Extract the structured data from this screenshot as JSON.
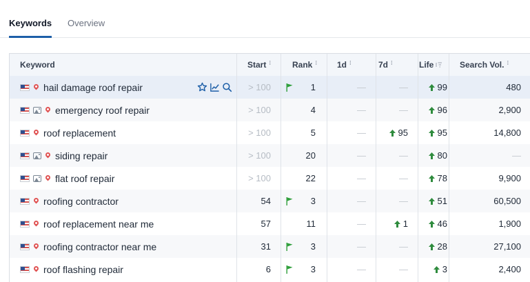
{
  "tabs": [
    {
      "label": "Keywords",
      "active": true
    },
    {
      "label": "Overview",
      "active": false
    }
  ],
  "columns": {
    "keyword": "Keyword",
    "start": "Start",
    "rank": "Rank",
    "d1": "1d",
    "d7": "7d",
    "life": "Life",
    "search_vol": "Search Vol."
  },
  "colors": {
    "accent": "#1d5fa8",
    "up_arrow": "#2e8b3d",
    "flag": "#2e9e3a"
  },
  "rows": [
    {
      "keyword": "hail damage roof repair",
      "image_icon": false,
      "start": "> 100",
      "start_muted": true,
      "rank_flag": true,
      "rank": "1",
      "d1": "—",
      "d1_up": false,
      "d7": "—",
      "d7_up": false,
      "life": "99",
      "life_up": true,
      "volume": "480",
      "volume_muted": false,
      "highlighted": true
    },
    {
      "keyword": "emergency roof repair",
      "image_icon": true,
      "start": "> 100",
      "start_muted": true,
      "rank_flag": false,
      "rank": "4",
      "d1": "—",
      "d1_up": false,
      "d7": "—",
      "d7_up": false,
      "life": "96",
      "life_up": true,
      "volume": "2,900",
      "volume_muted": false,
      "highlighted": false
    },
    {
      "keyword": "roof replacement",
      "image_icon": false,
      "start": "> 100",
      "start_muted": true,
      "rank_flag": false,
      "rank": "5",
      "d1": "—",
      "d1_up": false,
      "d7": "95",
      "d7_up": true,
      "life": "95",
      "life_up": true,
      "volume": "14,800",
      "volume_muted": false,
      "highlighted": false
    },
    {
      "keyword": "siding repair",
      "image_icon": true,
      "start": "> 100",
      "start_muted": true,
      "rank_flag": false,
      "rank": "20",
      "d1": "—",
      "d1_up": false,
      "d7": "—",
      "d7_up": false,
      "life": "80",
      "life_up": true,
      "volume": "—",
      "volume_muted": true,
      "highlighted": false
    },
    {
      "keyword": "flat roof repair",
      "image_icon": true,
      "start": "> 100",
      "start_muted": true,
      "rank_flag": false,
      "rank": "22",
      "d1": "—",
      "d1_up": false,
      "d7": "—",
      "d7_up": false,
      "life": "78",
      "life_up": true,
      "volume": "9,900",
      "volume_muted": false,
      "highlighted": false
    },
    {
      "keyword": "roofing contractor",
      "image_icon": false,
      "start": "54",
      "start_muted": false,
      "rank_flag": true,
      "rank": "3",
      "d1": "—",
      "d1_up": false,
      "d7": "—",
      "d7_up": false,
      "life": "51",
      "life_up": true,
      "volume": "60,500",
      "volume_muted": false,
      "highlighted": false
    },
    {
      "keyword": "roof replacement near me",
      "image_icon": false,
      "start": "57",
      "start_muted": false,
      "rank_flag": false,
      "rank": "11",
      "d1": "—",
      "d1_up": false,
      "d7": "1",
      "d7_up": true,
      "life": "46",
      "life_up": true,
      "volume": "1,900",
      "volume_muted": false,
      "highlighted": false
    },
    {
      "keyword": "roofing contractor near me",
      "image_icon": false,
      "start": "31",
      "start_muted": false,
      "rank_flag": true,
      "rank": "3",
      "d1": "—",
      "d1_up": false,
      "d7": "—",
      "d7_up": false,
      "life": "28",
      "life_up": true,
      "volume": "27,100",
      "volume_muted": false,
      "highlighted": false
    },
    {
      "keyword": "roof flashing repair",
      "image_icon": false,
      "start": "6",
      "start_muted": false,
      "rank_flag": true,
      "rank": "3",
      "d1": "—",
      "d1_up": false,
      "d7": "—",
      "d7_up": false,
      "life": "3",
      "life_up": true,
      "volume": "2,400",
      "volume_muted": false,
      "highlighted": false
    }
  ]
}
